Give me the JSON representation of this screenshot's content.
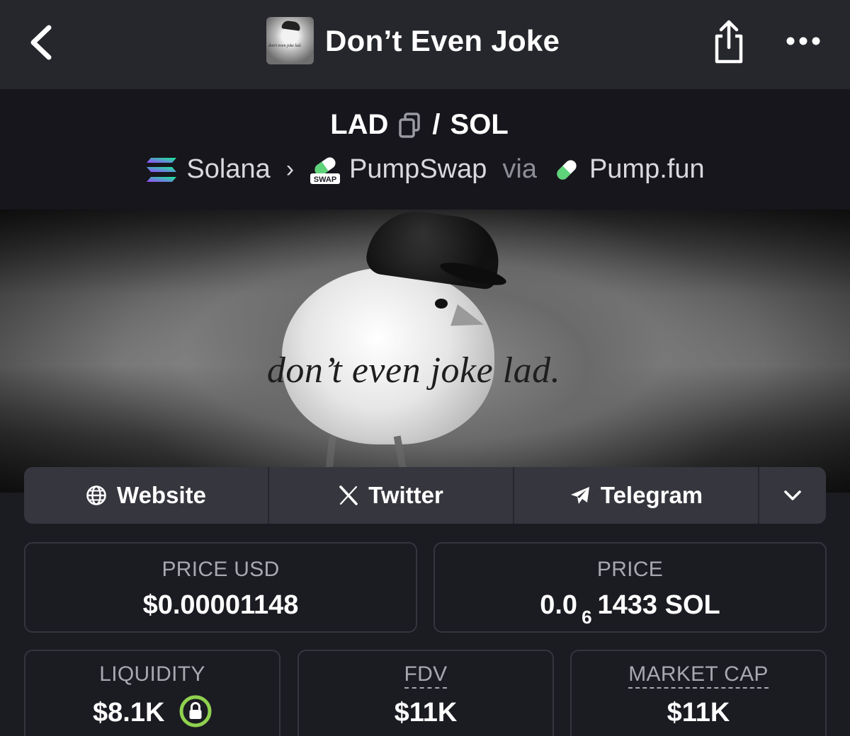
{
  "header": {
    "title": "Don’t Even Joke",
    "avatar_caption": "don't even joke lad.",
    "icons": {
      "back": "chevron-left-icon",
      "share": "share-icon",
      "more": "more-horizontal-icon"
    }
  },
  "pair": {
    "base": "LAD",
    "separator": "/",
    "quote": "SOL",
    "chain": "Solana",
    "dex": "PumpSwap",
    "via": "via",
    "launchpad": "Pump.fun",
    "dex_badge": "SWAP"
  },
  "banner": {
    "caption": "don’t even joke lad."
  },
  "links": [
    {
      "label": "Website",
      "icon": "globe-icon"
    },
    {
      "label": "Twitter",
      "icon": "x-logo-icon"
    },
    {
      "label": "Telegram",
      "icon": "telegram-icon"
    }
  ],
  "stats": {
    "price_usd": {
      "label": "PRICE USD",
      "value": "$0.00001148"
    },
    "price": {
      "label": "PRICE",
      "prefix": "0.0",
      "zeros": "6",
      "suffix": "1433 SOL"
    },
    "liquidity": {
      "label": "LIQUIDITY",
      "value": "$8.1K"
    },
    "fdv": {
      "label": "FDV",
      "value": "$11K"
    },
    "market_cap": {
      "label": "MARKET CAP",
      "value": "$11K"
    }
  },
  "colors": {
    "accent_green": "#8fd14f",
    "solana_purple": "#9945ff",
    "solana_teal": "#14f195"
  }
}
